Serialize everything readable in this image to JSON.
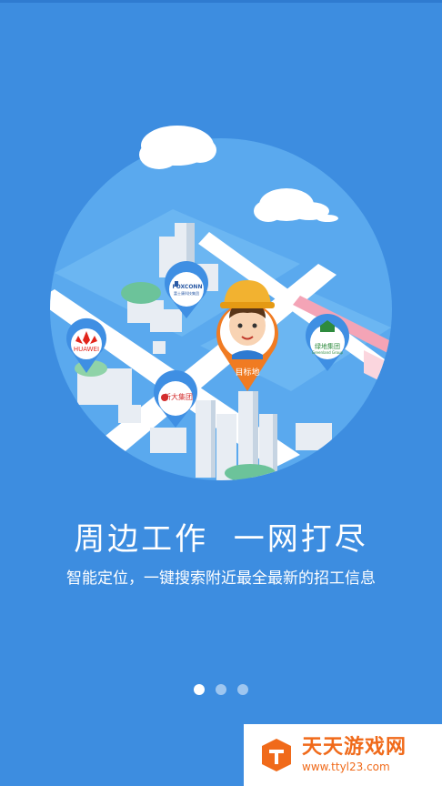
{
  "colors": {
    "background": "#3d8de0",
    "circle": "#5aa9ee",
    "road": "#ffffff",
    "pin_blue": "#3f8fe3",
    "pin_orange": "#f07b22",
    "watermark_orange": "#f06a1a"
  },
  "map": {
    "pins": [
      {
        "label": "HUAWEI",
        "icon": "huawei-logo-icon"
      },
      {
        "label": "FOXCONN",
        "sublabel": "富士康科技集团",
        "icon": "foxconn-logo-icon"
      },
      {
        "label": "新大集团",
        "icon": "xinda-logo-icon"
      },
      {
        "label": "绿地集团",
        "sublabel": "Greenland Group",
        "icon": "greenland-logo-icon"
      }
    ],
    "target_label": "目标地",
    "target_icon": "worker-avatar-icon"
  },
  "onboarding": {
    "title": "周边工作  一网打尽",
    "subtitle": "智能定位，一键搜索附近最全最新的招工信息",
    "page_count": 3,
    "active_page": 1
  },
  "watermark": {
    "title": "天天游戏网",
    "url": "www.ttyl23.com",
    "icon": "ttyl-logo-icon"
  }
}
